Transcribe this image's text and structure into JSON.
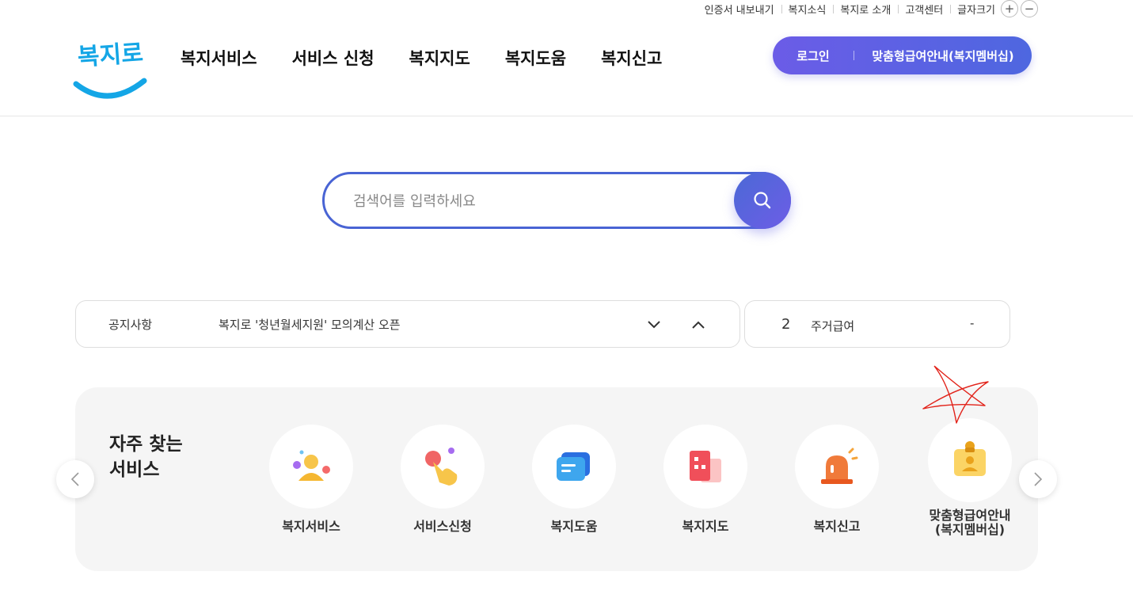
{
  "utility_bar": {
    "links": [
      "인증서 내보내기",
      "복지소식",
      "복지로 소개",
      "고객센터",
      "글자크기"
    ],
    "font_plus": "+",
    "font_minus": "−"
  },
  "header": {
    "logo_text": "복지로",
    "nav": [
      "복지서비스",
      "서비스 신청",
      "복지지도",
      "복지도움",
      "복지신고"
    ],
    "login_label": "로그인",
    "membership_label": "맞춤형급여안내(복지멤버십)",
    "accent_color": "#5b63e3"
  },
  "search": {
    "placeholder": "검색어를 입력하세요",
    "value": ""
  },
  "notice": {
    "label": "공지사항",
    "text": "복지로 '청년월세지원' 모의계산 오픈"
  },
  "ranking": {
    "number": "2",
    "text": "주거급여",
    "change": "-"
  },
  "frequent": {
    "title_line1": "자주 찾는",
    "title_line2": "서비스",
    "items": [
      {
        "label": "복지서비스",
        "icon": "person-service-icon"
      },
      {
        "label": "서비스신청",
        "icon": "hand-tap-icon"
      },
      {
        "label": "복지도움",
        "icon": "chat-bubble-icon"
      },
      {
        "label": "복지지도",
        "icon": "building-map-icon"
      },
      {
        "label": "복지신고",
        "icon": "siren-icon"
      },
      {
        "label_line1": "맞춤형급여안내",
        "label_line2": "(복지멤버십)",
        "icon": "membership-card-icon"
      }
    ]
  }
}
